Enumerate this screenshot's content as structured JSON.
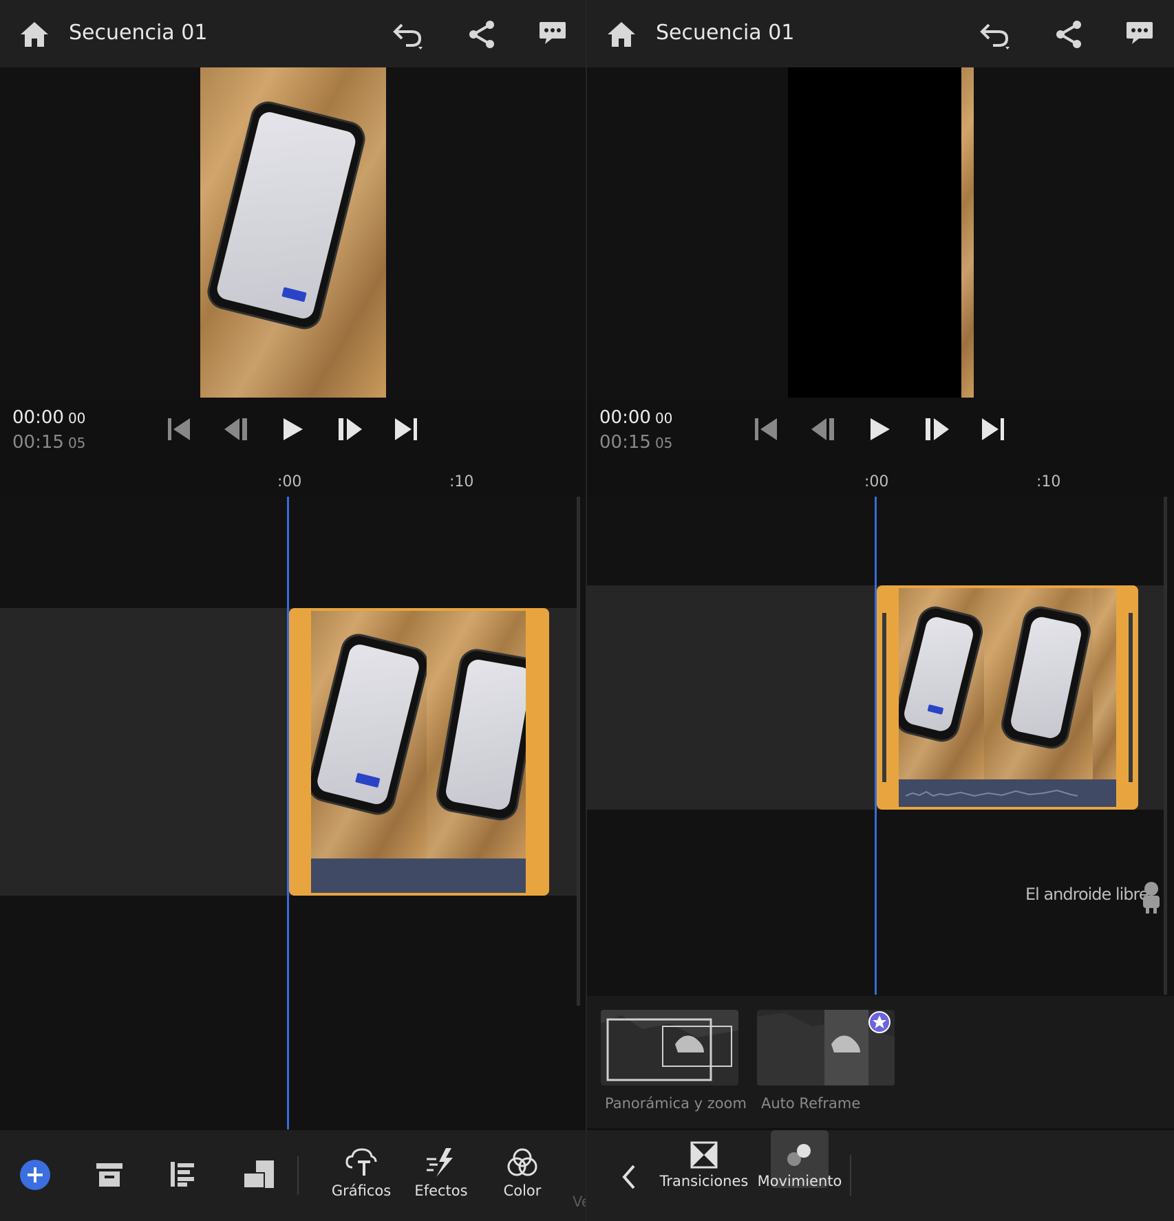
{
  "left_panel": {
    "header": {
      "title": "Secuencia 01"
    },
    "timecode": {
      "current": "00:00",
      "current_frames": "00",
      "duration": "00:15",
      "duration_frames": "05"
    },
    "ruler": {
      "tick_0": ":00",
      "tick_1": ":10"
    },
    "toolbar": {
      "graficos": "Gráficos",
      "efectos": "Efectos",
      "color": "Color",
      "partial": "Ve"
    }
  },
  "right_panel": {
    "header": {
      "title": "Secuencia 01"
    },
    "timecode": {
      "current": "00:00",
      "current_frames": "00",
      "duration": "00:15",
      "duration_frames": "05"
    },
    "ruler": {
      "tick_0": ":00",
      "tick_1": ":10"
    },
    "watermark": "El androide libre",
    "motion_options": [
      {
        "label": "Panorámica y zoom"
      },
      {
        "label": "Auto Reframe",
        "badge": "premium-star-icon"
      }
    ],
    "toolbar": {
      "transiciones": "Transiciones",
      "movimiento": "Movimiento"
    }
  },
  "colors": {
    "accent_blue": "#3a6bd6",
    "clip_orange": "#e8a53f",
    "add_button": "#3b6fe0",
    "premium_purple": "#6b63e0"
  }
}
